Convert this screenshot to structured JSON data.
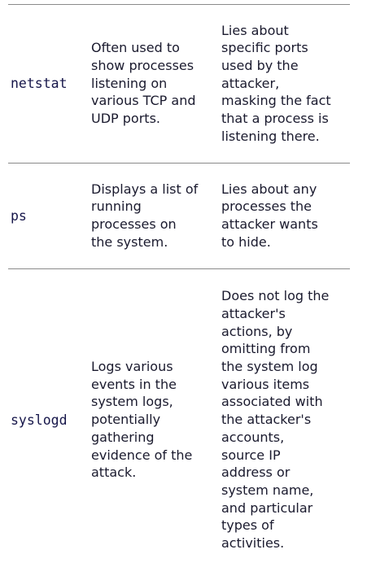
{
  "rows": [
    {
      "command": "netstat",
      "description": "Often used to\nshow processes\nlistening on\nvarious TCP and\nUDP ports.",
      "effect": "Lies about\nspecific ports\nused by the\nattacker,\nmasking the fact\nthat a process is\nlistening there."
    },
    {
      "command": "ps",
      "description": "Displays a list of\nrunning\nprocesses on\nthe system.",
      "effect": "Lies about any\nprocesses the\nattacker wants\nto hide."
    },
    {
      "command": "syslogd",
      "description": "Logs various\nevents in the\nsystem logs,\npotentially\ngathering\nevidence of the\nattack.",
      "effect": "Does not log the\nattacker's\nactions, by\nomitting from\nthe system log\nvarious items\nassociated with\nthe attacker's\naccounts,\nsource IP\naddress or\nsystem name,\nand particular\ntypes of\nactivities."
    }
  ]
}
